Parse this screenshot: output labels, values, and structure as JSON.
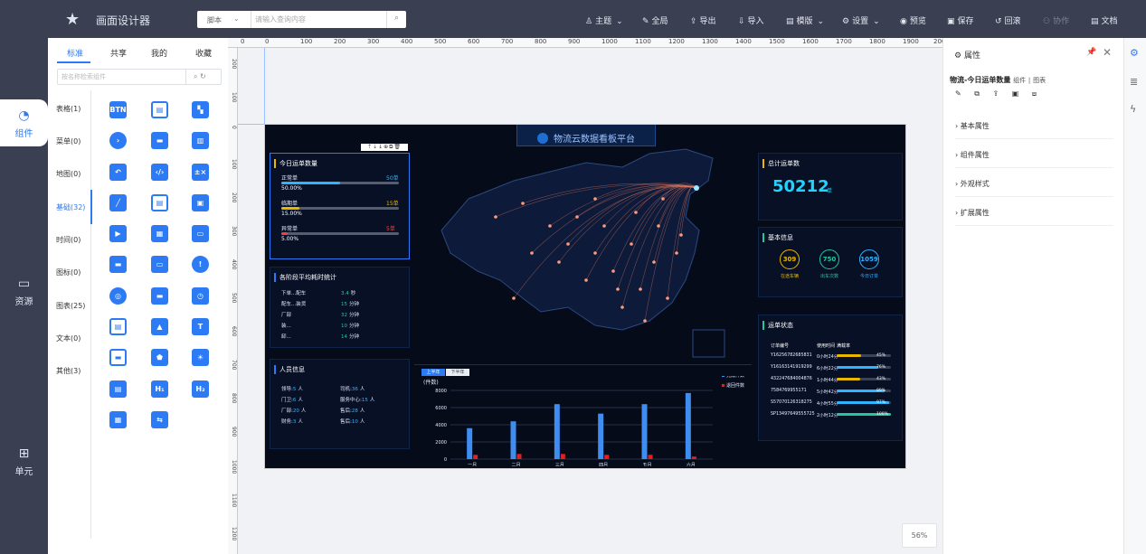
{
  "app": {
    "title": "画面设计器",
    "logo_icon": "star-icon"
  },
  "search": {
    "type": "脚本",
    "placeholder": "请输入查询内容"
  },
  "top_menu": [
    {
      "label": "主题",
      "icon": "tshirt-icon",
      "dropdown": true
    },
    {
      "label": "全局",
      "icon": "edit-icon"
    },
    {
      "label": "导出",
      "icon": "upload-icon"
    },
    {
      "label": "导入",
      "icon": "download-icon"
    },
    {
      "label": "模版",
      "icon": "template-icon",
      "dropdown": true
    },
    {
      "label": "设置",
      "icon": "gear-icon",
      "dropdown": true
    },
    {
      "label": "预览",
      "icon": "eye-icon"
    },
    {
      "label": "保存",
      "icon": "save-icon"
    },
    {
      "label": "回滚",
      "icon": "history-icon"
    },
    {
      "label": "协作",
      "icon": "collab-icon",
      "disabled": true
    },
    {
      "label": "文档",
      "icon": "document-icon"
    }
  ],
  "iconbar": [
    {
      "label": "组件",
      "icon": "component-icon",
      "active": true
    },
    {
      "label": "资源",
      "icon": "folder-icon"
    },
    {
      "label": "单元",
      "icon": "unit-icon"
    }
  ],
  "panel": {
    "tabs": [
      "标准",
      "共享",
      "我的",
      "收藏"
    ],
    "search_placeholder": "按名称检索组件",
    "categories": [
      "表格(1)",
      "菜单(0)",
      "地图(0)",
      "基础(32)",
      "时间(0)",
      "图标(0)",
      "图表(25)",
      "文本(0)",
      "其他(3)"
    ],
    "active_category": "基础(32)",
    "component_glyphs": [
      "BTN",
      "▤",
      "▚",
      "›",
      "▬",
      "▥",
      "↶",
      "‹/›",
      "±×",
      "╱",
      "▤",
      "▣",
      "▶",
      "▦",
      "▭",
      "▬",
      "▭",
      "!",
      "◎",
      "▬",
      "◷",
      "▤",
      "▲",
      "T",
      "▬",
      "⬟",
      "☀",
      "▤",
      "H₁",
      "H₂",
      "▦",
      "⇆"
    ]
  },
  "ruler": {
    "top": [
      "0",
      "0",
      "100",
      "200",
      "300",
      "400",
      "500",
      "600",
      "700",
      "800",
      "900",
      "1000",
      "1100",
      "1200",
      "1300",
      "1400",
      "1500",
      "1600",
      "1700",
      "1800",
      "1900",
      "200"
    ],
    "left": [
      "200",
      "100",
      "0",
      "100",
      "200",
      "300",
      "400",
      "500",
      "600",
      "700",
      "800",
      "900",
      "1000",
      "1100",
      "1200"
    ]
  },
  "dashboard": {
    "title": "物流云数据看板平台",
    "left1": {
      "title": "今日运单数量",
      "items": [
        {
          "label": "正常单",
          "count": "50单",
          "percent": "50.00%",
          "color": "#2fb4ff",
          "fraction": 0.5
        },
        {
          "label": "临期单",
          "count": "15单",
          "percent": "15.00%",
          "color": "#e8b800",
          "fraction": 0.15
        },
        {
          "label": "异常单",
          "count": "5单",
          "percent": "5.00%",
          "color": "#ff3b3b",
          "fraction": 0.05
        }
      ]
    },
    "left2": {
      "title": "各阶段平均耗时统计",
      "rows": [
        {
          "label": "下单...配车",
          "value": "3.4",
          "unit": "秒"
        },
        {
          "label": "配车...装货",
          "value": "15",
          "unit": "分钟"
        },
        {
          "label": "厂部",
          "value": "32",
          "unit": "分钟"
        },
        {
          "label": "装...",
          "value": "10",
          "unit": "分钟"
        },
        {
          "label": "卸...",
          "value": "14",
          "unit": "分钟"
        }
      ]
    },
    "left3": {
      "title": "人员信息",
      "rows": [
        {
          "k1": "领导:",
          "v1": "5",
          "u1": "人",
          "k2": "司机:",
          "v2": "36",
          "u2": "人"
        },
        {
          "k1": "门卫:",
          "v1": "6",
          "u1": "人",
          "k2": "服务中心:",
          "v2": "15",
          "u2": "人"
        },
        {
          "k1": "厂部:",
          "v1": "20",
          "u1": "人",
          "k2": "售后:",
          "v2": "28",
          "u2": "人"
        },
        {
          "k1": "财务:",
          "v1": "3",
          "u1": "人",
          "k2": "售后:",
          "v2": "10",
          "u2": "人"
        }
      ]
    },
    "right1": {
      "title": "总计运单数",
      "value": "50212",
      "unit": "单"
    },
    "right2": {
      "title": "基本信息",
      "circles": [
        {
          "value": "309",
          "label": "在途车辆",
          "color": "#e8b800"
        },
        {
          "value": "750",
          "label": "出车次数",
          "color": "#22c7a0"
        },
        {
          "value": "1059",
          "label": "今日订单",
          "color": "#2fb4ff"
        }
      ]
    },
    "right3": {
      "title": "运单状态",
      "headers": [
        "订单编号",
        "使用时间",
        "满载率"
      ],
      "rows": [
        {
          "id": "Y16256782685831",
          "time": "0小时24分",
          "pct": "45%",
          "value": 0.45,
          "color": "#e8b800"
        },
        {
          "id": "Y16163141919299",
          "time": "6小时22分",
          "pct": "76%",
          "value": 0.76,
          "color": "#2fb4ff"
        },
        {
          "id": "432247684004876",
          "time": "1小时44分",
          "pct": "43%",
          "value": 0.43,
          "color": "#e8b800"
        },
        {
          "id": "7584769955171",
          "time": "5小时42分",
          "pct": "89%",
          "value": 0.89,
          "color": "#2fb4ff"
        },
        {
          "id": "S57070126318275",
          "time": "4小时55分",
          "pct": "97%",
          "value": 0.97,
          "color": "#2fb4ff"
        },
        {
          "id": "SP13497649555725",
          "time": "2小时12分",
          "pct": "100%",
          "value": 1.0,
          "color": "#22c7a0"
        }
      ]
    },
    "chart": {
      "tabs": [
        "上半年",
        "下半年"
      ],
      "active_tab": "上半年"
    }
  },
  "chart_data": {
    "type": "bar",
    "categories": [
      "一月",
      "二月",
      "三月",
      "四月",
      "五月",
      "六月"
    ],
    "ylabel": "(件数)",
    "ylim": [
      0,
      8000
    ],
    "yticks": [
      "8000",
      "6000",
      "4000",
      "2000",
      "0"
    ],
    "series": [
      {
        "name": "完成件数",
        "color": "#3d8ef0",
        "values": [
          3600,
          4400,
          6400,
          5300,
          6400,
          7700
        ]
      },
      {
        "name": "退回件数",
        "color": "#e02020",
        "values": [
          500,
          600,
          600,
          500,
          500,
          300
        ]
      }
    ]
  },
  "properties": {
    "header": "属性",
    "component_name": "物流-今日运单数量",
    "component_type": "组件",
    "component_category": "图表",
    "tools": "✎ ⧉ ⇪ ▣ ⧈",
    "sections": [
      "基本属性",
      "组件属性",
      "外观样式",
      "扩展属性"
    ]
  },
  "zoom": "56%"
}
